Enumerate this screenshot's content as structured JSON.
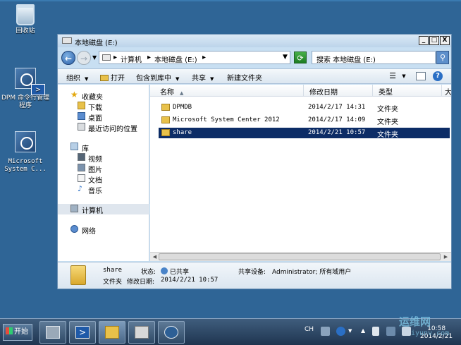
{
  "desktop": {
    "icons": [
      {
        "label": "回收站"
      },
      {
        "label": "DPM 命令行管理程序"
      },
      {
        "label": "Microsoft System C..."
      }
    ]
  },
  "window": {
    "title": "本地磁盘 (E:)",
    "controls": {
      "minimize": "_",
      "maximize": "□",
      "close": "X"
    }
  },
  "address": {
    "crumbs": [
      "计算机",
      "本地磁盘 (E:)"
    ],
    "search_placeholder": "搜索 本地磁盘 (E:)"
  },
  "toolbar": {
    "organize": "组织",
    "open": "打开",
    "include_in_library": "包含到库中",
    "share": "共享",
    "new_folder": "新建文件夹"
  },
  "nav": {
    "favorites": "收藏夹",
    "downloads": "下载",
    "desktop": "桌面",
    "recent": "最近访问的位置",
    "libraries": "库",
    "videos": "视频",
    "pictures": "图片",
    "documents": "文档",
    "music": "音乐",
    "computer": "计算机",
    "network": "网络"
  },
  "columns": {
    "name": "名称",
    "modified": "修改日期",
    "type": "类型",
    "size": "大"
  },
  "files": [
    {
      "name": "DPMDB",
      "modified": "2014/2/17 14:31",
      "type": "文件夹"
    },
    {
      "name": "Microsoft System Center 2012",
      "modified": "2014/2/17 14:09",
      "type": "文件夹"
    },
    {
      "name": "share",
      "modified": "2014/2/21 10:57",
      "type": "文件夹"
    }
  ],
  "details": {
    "name": "share",
    "kind": "文件夹",
    "state_label": "状态:",
    "state_value": "已共享",
    "share_label": "共享设备:",
    "share_value": "Administrator; 所有域用户",
    "modified_label": "修改日期:",
    "modified_value": "2014/2/21 10:57"
  },
  "taskbar": {
    "start": "开始",
    "lang": "CH",
    "clock_time": "10:58",
    "clock_date": "2014/2/21"
  },
  "watermark": {
    "line1": "运维网",
    "line2": "iyunv.com"
  }
}
